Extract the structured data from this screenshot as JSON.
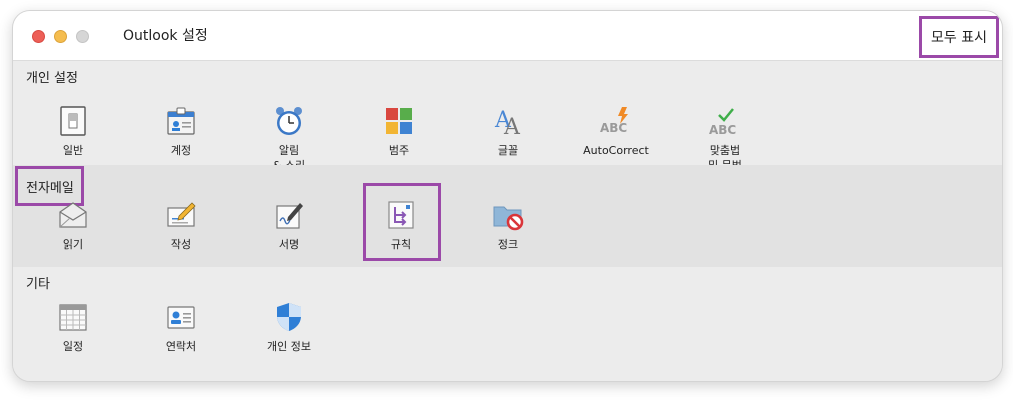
{
  "window": {
    "title": "Outlook 설정",
    "show_all": "모두 표시"
  },
  "sections": {
    "personal": {
      "label": "개인 설정",
      "items": [
        "일반",
        "계정",
        "알림\n& 소리",
        "범주",
        "글꼴",
        "AutoCorrect",
        "맞춤법\n및 문법"
      ]
    },
    "email": {
      "label": "전자메일",
      "items": [
        "읽기",
        "작성",
        "서명",
        "규칙",
        "정크"
      ]
    },
    "other": {
      "label": "기타",
      "items": [
        "일정",
        "연락처",
        "개인 정보"
      ]
    }
  },
  "icons": {
    "personal": [
      "general-icon",
      "accounts-icon",
      "alarm-clock-icon",
      "categories-icon",
      "fonts-icon",
      "autocorrect-icon",
      "spelling-check-icon"
    ],
    "email": [
      "envelope-icon",
      "compose-icon",
      "signature-icon",
      "rules-icon",
      "junk-folder-icon"
    ],
    "other": [
      "calendar-icon",
      "contact-card-icon",
      "privacy-shield-icon"
    ]
  },
  "colors": {
    "highlight": "#9b49a8",
    "accent_blue": "#2f7fd6"
  }
}
